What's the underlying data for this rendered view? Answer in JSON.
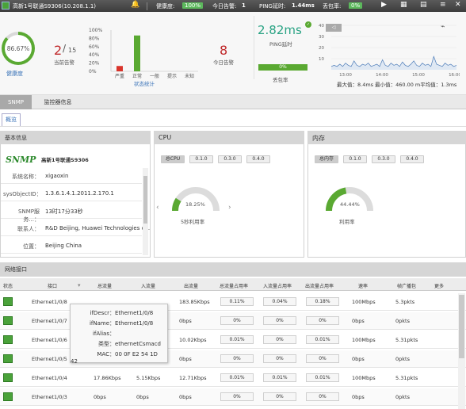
{
  "topbar": {
    "device_title": "高新1号联通S9306(10.208.1.1)",
    "health_label": "健康度:",
    "health_value": "100%",
    "alarms_today_label": "今日告警:",
    "alarms_today_value": "1",
    "ping_label": "PING延时:",
    "ping_value": "1.44ms",
    "loss_label": "丢包率:",
    "loss_value": "0%"
  },
  "summary": {
    "health_percent": "86.67%",
    "health_label": "健康度",
    "current_alarms_num": "2",
    "current_alarms_total": "15",
    "current_alarms_label": "当前告警",
    "alarm_stats_title": "状态统计",
    "alarm_stats_chart": {
      "type": "bar",
      "ylabels": [
        "100%",
        "80%",
        "60%",
        "40%",
        "20%",
        "0%"
      ],
      "categories": [
        "严重",
        "正常",
        "一般",
        "提示",
        "未知"
      ],
      "values": [
        13,
        87,
        0,
        0,
        0
      ],
      "colors": [
        "#d9342b",
        "#5aa932",
        "#5aa932",
        "#5aa932",
        "#5aa932"
      ]
    },
    "today_alarm_num": "8",
    "today_alarm_label": "今日告警",
    "ping_big": "2.82ms",
    "ping_big_label": "PING延时",
    "loss_bar_value": "0%",
    "loss_bar_label": "丢包率",
    "ping_chart": {
      "y_labels": [
        "40",
        "30",
        "20",
        "10"
      ],
      "x_labels": [
        "13:00",
        "14:00",
        "15:00",
        "16:00"
      ],
      "series_values": [
        3,
        4,
        3,
        5,
        3,
        6,
        4,
        3,
        8,
        4,
        3,
        5,
        4,
        6,
        3,
        4,
        5,
        3,
        9,
        4,
        3,
        6,
        4,
        5,
        3,
        7,
        4,
        3,
        5,
        8,
        4,
        3,
        6,
        4,
        5,
        3,
        12,
        5,
        4,
        3,
        6,
        4,
        5,
        3,
        4
      ]
    },
    "ping_stats": "最大值：8.4ms  最小值：460.00 m平均值：1.3ms"
  },
  "tabs": {
    "snmp": "SNMP",
    "monitor": "监控器信息",
    "overview": "概览"
  },
  "basic_info": {
    "title": "基本信息",
    "snmp_logo": "SNMP",
    "device_name": "高新1号联通S9306",
    "rows": [
      {
        "label": "系统名称：",
        "value": "xigaoxin"
      },
      {
        "label": "sysObjectID：",
        "value": "1.3.6.1.4.1.2011.2.170.1"
      },
      {
        "label": "SNMP服务...：",
        "value": "13时17分33秒"
      },
      {
        "label": "联系人：",
        "value": "R&D Beijing, Huawei Technologies c..."
      },
      {
        "label": "位置：",
        "value": "Beijing China"
      }
    ]
  },
  "cpu": {
    "title": "CPU",
    "buttons": [
      "总CPU",
      "0.1.0",
      "0.3.0",
      "0.4.0"
    ],
    "percent": "18.25%",
    "percent_value": 18.25,
    "caption": "5秒利用率"
  },
  "memory": {
    "title": "内存",
    "buttons": [
      "总内存",
      "0.1.0",
      "0.3.0",
      "0.4.0"
    ],
    "percent": "44.44%",
    "percent_value": 44.44,
    "caption": "利用率"
  },
  "network": {
    "title": "网络接口",
    "headers": [
      "状态",
      "接口",
      "总流量",
      "入流量",
      "出流量",
      "总流量占用率",
      "入流量占用率",
      "出流量占用率",
      "速率",
      "帧广播包",
      "更多"
    ],
    "rows": [
      {
        "iface": "Ethernet1/0/8",
        "total": "",
        "in": "",
        "out": "183.85Kbps",
        "total_pct": "0.11%",
        "in_pct": "0.04%",
        "out_pct": "0.18%",
        "speed": "100Mbps",
        "bcast": "5.3pkts"
      },
      {
        "iface": "Ethernet1/0/7",
        "total": "",
        "in": "",
        "out": "0bps",
        "total_pct": "0%",
        "in_pct": "0%",
        "out_pct": "0%",
        "speed": "0bps",
        "bcast": "0pkts"
      },
      {
        "iface": "Ethernet1/0/6",
        "total": "",
        "in": "",
        "out": "10.02Kbps",
        "total_pct": "0.01%",
        "in_pct": "0%",
        "out_pct": "0.01%",
        "speed": "100Mbps",
        "bcast": "5.31pkts"
      },
      {
        "iface": "Ethernet1/0/5",
        "total": "",
        "in": "",
        "out": "0bps",
        "total_pct": "0%",
        "in_pct": "0%",
        "out_pct": "0%",
        "speed": "0bps",
        "bcast": "0pkts"
      },
      {
        "iface": "Ethernet1/0/4",
        "total": "17.86Kbps",
        "in": "5.15Kbps",
        "out": "12.71Kbps",
        "total_pct": "0.01%",
        "in_pct": "0.01%",
        "out_pct": "0.01%",
        "speed": "100Mbps",
        "bcast": "5.31pkts"
      },
      {
        "iface": "Ethernet1/0/3",
        "total": "0bps",
        "in": "0bps",
        "out": "0bps",
        "total_pct": "0%",
        "in_pct": "0%",
        "out_pct": "0%",
        "speed": "0bps",
        "bcast": "0pkts"
      }
    ]
  },
  "tooltip": {
    "lines": [
      {
        "label": "ifDescr：",
        "value": "Ethernet1/0/8"
      },
      {
        "label": "ifName：",
        "value": "Ethernet1/0/8"
      },
      {
        "label": "ifAlias：",
        "value": ""
      },
      {
        "label": "类型：",
        "value": "ethernetCsmacd"
      },
      {
        "label": "MAC：",
        "value": "00 0F E2 54 1D 42"
      }
    ]
  },
  "colors": {
    "accent_green": "#5aa932",
    "alarm_red": "#d9342b",
    "ping_teal": "#2aa384"
  }
}
